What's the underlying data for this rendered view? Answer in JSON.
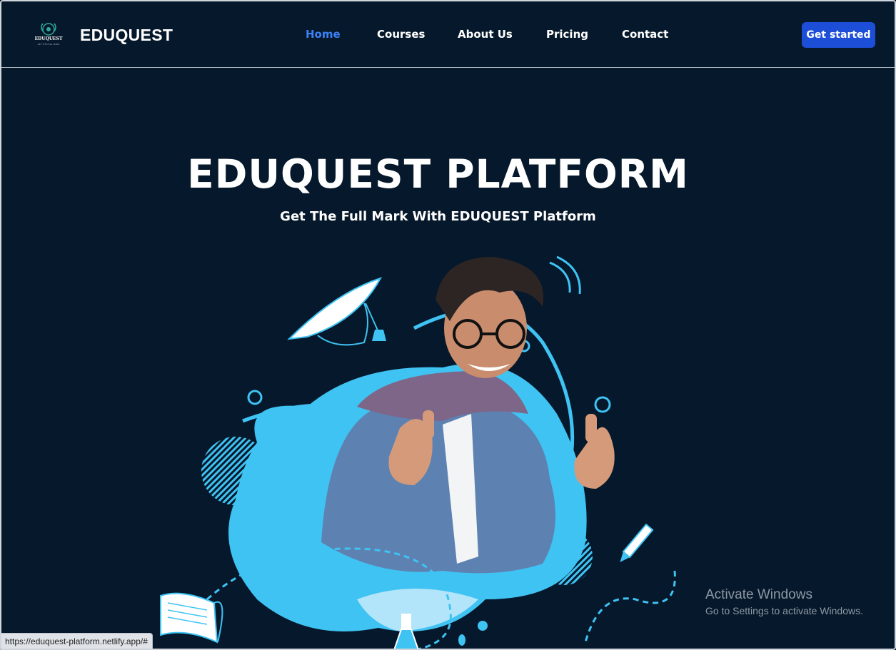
{
  "brand": {
    "name": "EDUQUEST",
    "logo_text": "EDUQUEST",
    "logo_tagline": "GET THE FULL MARK"
  },
  "nav": {
    "items": [
      {
        "label": "Home",
        "active": true
      },
      {
        "label": "Courses",
        "active": false
      },
      {
        "label": "About Us",
        "active": false
      },
      {
        "label": "Pricing",
        "active": false
      },
      {
        "label": "Contact",
        "active": false
      }
    ],
    "cta_label": "Get started"
  },
  "hero": {
    "title": "EDUQUEST PLATFORM",
    "subtitle": "Get The Full Mark With EDUQUEST Platform"
  },
  "system": {
    "activate_title": "Activate Windows",
    "activate_sub": "Go to Settings to activate Windows.",
    "status_url": "https://eduquest-platform.netlify.app/#"
  },
  "colors": {
    "background": "#06182b",
    "accent": "#3b82f6",
    "cta": "#1d4ed8",
    "blob": "#3fc3f3"
  }
}
